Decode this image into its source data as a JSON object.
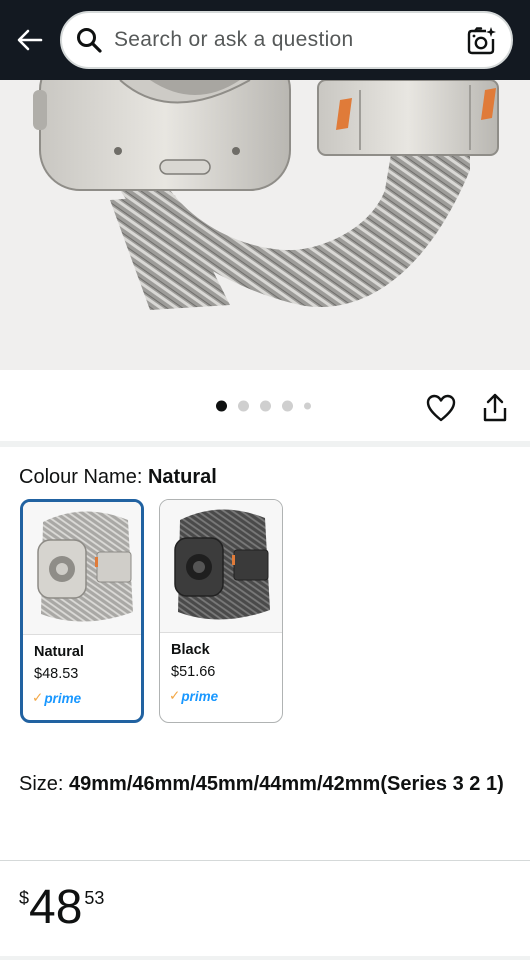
{
  "search": {
    "placeholder": "Search or ask a question"
  },
  "icons": {
    "back": "arrow-left-icon",
    "search": "magnifier-icon",
    "camera": "camera-sparkle-icon",
    "wishlist": "heart-icon",
    "share": "share-icon"
  },
  "gallery": {
    "image_count": 5,
    "active_index": 0
  },
  "colour": {
    "label": "Colour Name:",
    "selected": "Natural",
    "options": [
      {
        "name": "Natural",
        "price": "$48.53",
        "prime": "prime",
        "selected": true
      },
      {
        "name": "Black",
        "price": "$51.66",
        "prime": "prime",
        "selected": false
      }
    ]
  },
  "size": {
    "label": "Size:",
    "value": "49mm/46mm/45mm/44mm/42mm(Series 3 2 1)"
  },
  "price": {
    "symbol": "$",
    "whole": "48",
    "fraction": "53"
  },
  "colors": {
    "topbar": "#131921",
    "selected_border": "#2162a1",
    "prime_blue": "#1a98ff",
    "prime_check": "#f3a847"
  }
}
